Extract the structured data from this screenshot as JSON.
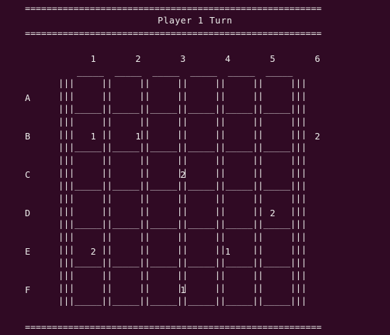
{
  "terminal": {
    "separator": "=======================================================",
    "title": "Player 1 Turn",
    "column_headers": [
      "1",
      "2",
      "3",
      "4",
      "5",
      "6"
    ],
    "row_labels": [
      "A",
      "B",
      "C",
      "D",
      "E",
      "F"
    ],
    "top_cell_line": "_____  _____  _____  _____  _____  _____",
    "cell_border_line": "|||     ||     ||     ||     ||     ||     |||",
    "cell_bottom_line": "|||_____||_____||_____||_____||_____||_____|||",
    "cells": [
      [
        "",
        "",
        "",
        "",
        "",
        ""
      ],
      [
        "1",
        "1",
        "",
        "",
        "",
        "2"
      ],
      [
        "",
        "",
        "2",
        "",
        "",
        ""
      ],
      [
        "",
        "",
        "",
        "",
        "2",
        ""
      ],
      [
        "2",
        "",
        "",
        "1",
        "",
        ""
      ],
      [
        "",
        "",
        "1",
        "",
        "",
        ""
      ]
    ]
  }
}
